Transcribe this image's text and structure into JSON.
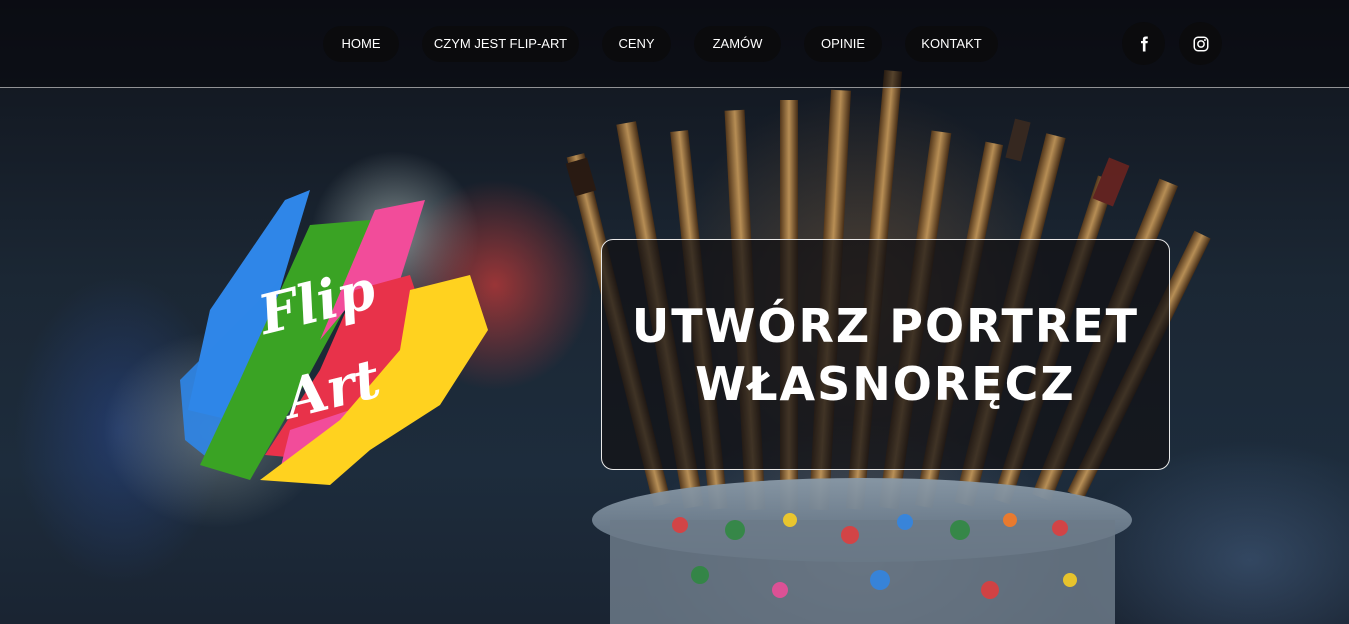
{
  "nav": {
    "items": [
      {
        "label": "HOME"
      },
      {
        "label": "CZYM JEST FLIP-ART"
      },
      {
        "label": "CENY"
      },
      {
        "label": "ZAMÓW"
      },
      {
        "label": "OPINIE"
      },
      {
        "label": "KONTAKT"
      }
    ]
  },
  "social": {
    "facebook_icon": "facebook-icon",
    "instagram_icon": "instagram-icon"
  },
  "logo": {
    "line1": "Flip",
    "line2": "Art",
    "colors": [
      "#2f86e8",
      "#3aa324",
      "#e8324a",
      "#f24c9a",
      "#ffd21f"
    ]
  },
  "hero": {
    "title_line1": "UTWÓRZ PORTRET",
    "title_line2": "WŁASNORĘCZ"
  }
}
